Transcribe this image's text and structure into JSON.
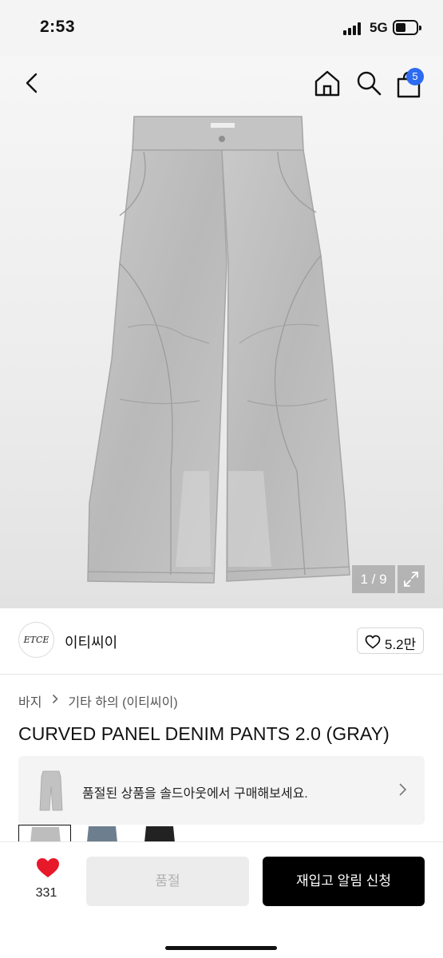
{
  "status_bar": {
    "time": "2:53",
    "network": "5G"
  },
  "nav": {
    "cart_count": "5"
  },
  "gallery": {
    "counter": "1 / 9"
  },
  "brand": {
    "logo_text": "ETCE",
    "name": "이티씨이",
    "likes": "5.2만"
  },
  "breadcrumb": {
    "category": "바지",
    "subcategory": "기타 하의 (이티씨이)"
  },
  "product": {
    "title": "CURVED PANEL DENIM PANTS 2.0 (GRAY)"
  },
  "soldout_banner": {
    "text": "품절된 상품을 솔드아웃에서 구매해보세요."
  },
  "bottom_bar": {
    "heart_count": "331",
    "soldout_label": "품절",
    "restock_label": "재입고 알림 신청"
  },
  "colors": {
    "accent_badge": "#2d6bf0",
    "heart": "#e8182b",
    "primary_button": "#000000",
    "disabled_button": "#ececec"
  }
}
